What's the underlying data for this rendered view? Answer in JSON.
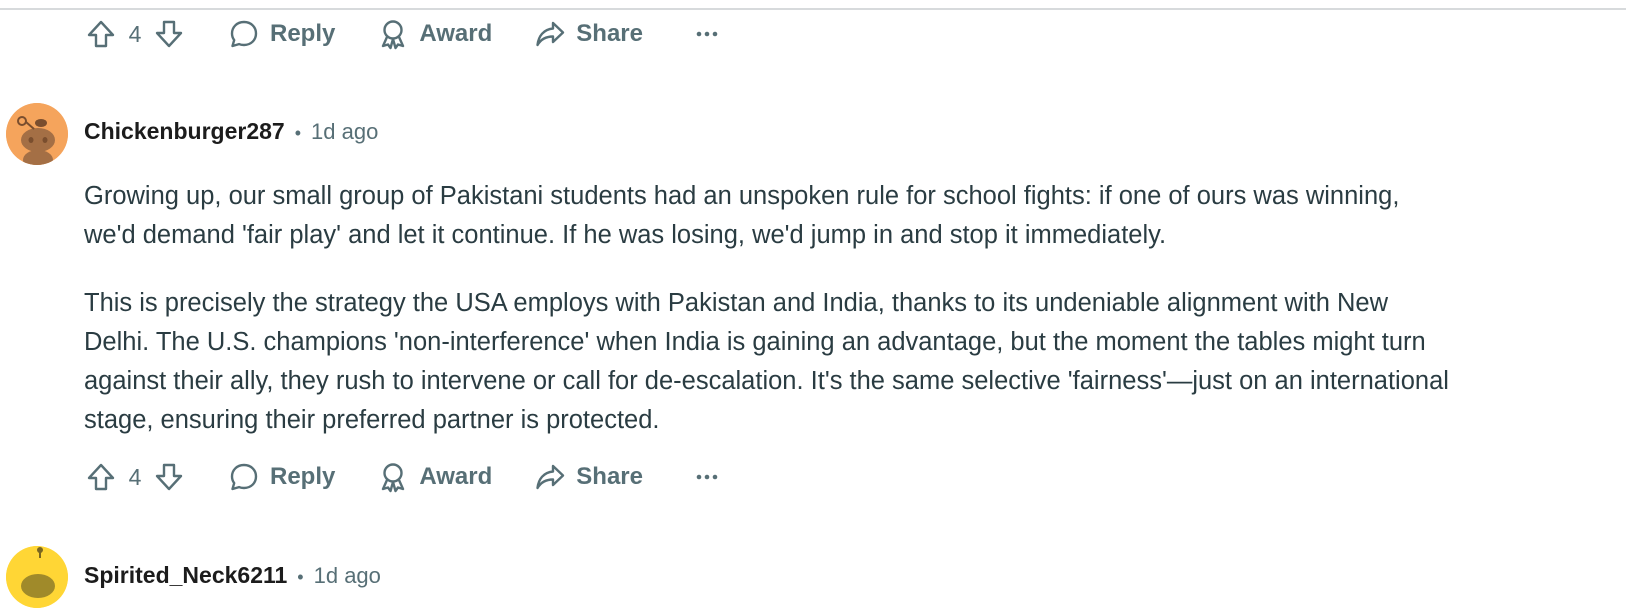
{
  "actions": {
    "vote_count": "4",
    "reply_label": "Reply",
    "award_label": "Award",
    "share_label": "Share",
    "more_label": "…"
  },
  "comments": [
    {
      "author": "Chickenburger287",
      "separator": "•",
      "time": "1d ago",
      "avatar_color": "#f5a45c",
      "paragraphs": [
        "Growing up, our small group of Pakistani students had an unspoken rule for school fights: if one of ours was winning, we'd demand 'fair play' and let it continue. If he was losing, we'd jump in and stop it immediately.",
        "This is precisely the strategy the USA employs with Pakistan and India, thanks to its undeniable alignment with New Delhi. The U.S. champions 'non-interference' when India is gaining an advantage, but the moment the tables might turn against their ally, they rush to intervene or call for de-escalation. It's the same selective 'fairness'—just on an international stage, ensuring their preferred partner is protected."
      ],
      "vote_count": "4"
    },
    {
      "author": "Spirited_Neck6211",
      "separator": "•",
      "time": "1d ago",
      "avatar_color": "#ffd635"
    }
  ],
  "colors": {
    "meta_gray": "#576f76",
    "text": "#2a3c42",
    "divider": "#d7dadc"
  }
}
